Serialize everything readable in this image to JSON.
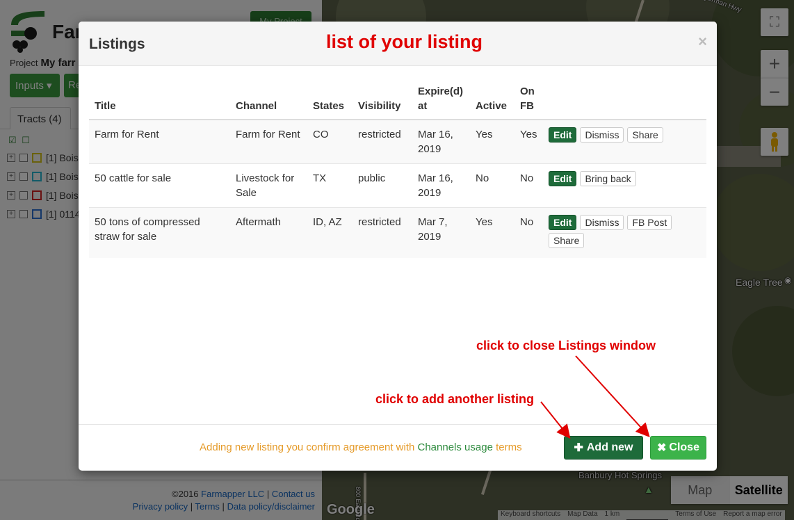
{
  "app": {
    "brand_prefix": "Far",
    "my_project_label": "My Project",
    "project_label": "Project",
    "project_name": "My farr",
    "inputs_label": "Inputs ▾",
    "re_label": "Re",
    "tracts_tab": "Tracts (4)",
    "tracts": [
      {
        "label": "[1] Bois",
        "color": "#d4c21a"
      },
      {
        "label": "[1] Bois",
        "color": "#27b6d1"
      },
      {
        "label": "[1] Bois",
        "color": "#d32222"
      },
      {
        "label": "[1] 0114",
        "color": "#2a6fd1"
      }
    ],
    "footer": {
      "copyright": "©2016",
      "company": "Farmapper LLC",
      "sep": "|",
      "contact": "Contact us",
      "privacy": "Privacy policy",
      "terms": "Terms",
      "data_policy": "Data policy/disclaimer"
    }
  },
  "map": {
    "highway": "yerman Hwy",
    "eagle_tree": "Eagle Tree",
    "banbury": "Banbury Hot Springs",
    "road_800": "800 East Rd",
    "maptype_map": "Map",
    "maptype_satellite": "Satellite",
    "google": "Google",
    "attribution": {
      "shortcuts": "Keyboard shortcuts",
      "map_data": "Map Data",
      "scale": "1 km",
      "terms": "Terms of Use",
      "report": "Report a map error"
    }
  },
  "modal": {
    "title": "Listings",
    "close_x": "×",
    "columns": [
      "Title",
      "Channel",
      "States",
      "Visibility",
      "Expire(d) at",
      "Active",
      "On FB"
    ],
    "rows": [
      {
        "title": "Farm for Rent",
        "channel": "Farm for Rent",
        "states": "CO",
        "visibility": "restricted",
        "expire": "Mar 16, 2019",
        "active": "Yes",
        "on_fb": "Yes",
        "actions": [
          "Edit",
          "Dismiss",
          "Share"
        ]
      },
      {
        "title": "50 cattle for sale",
        "channel": "Livestock for Sale",
        "states": "TX",
        "visibility": "public",
        "expire": "Mar 16, 2019",
        "active": "No",
        "on_fb": "No",
        "actions": [
          "Edit",
          "Bring back"
        ]
      },
      {
        "title": "50 tons of compressed straw for sale",
        "channel": "Aftermath",
        "states": "ID, AZ",
        "visibility": "restricted",
        "expire": "Mar 7, 2019",
        "active": "Yes",
        "on_fb": "No",
        "actions": [
          "Edit",
          "Dismiss",
          "FB Post",
          "Share"
        ]
      }
    ],
    "footer_note_pre": "Adding new listing you confirm agreement with ",
    "footer_note_channels": "Channels usage",
    "footer_note_terms": " terms",
    "add_new_label": "Add new",
    "close_label": "Close"
  },
  "annotations": {
    "list_title": "list of your listing",
    "close_hint": "click to close Listings window",
    "add_hint": "click to add another listing",
    "color": "#e00000"
  }
}
